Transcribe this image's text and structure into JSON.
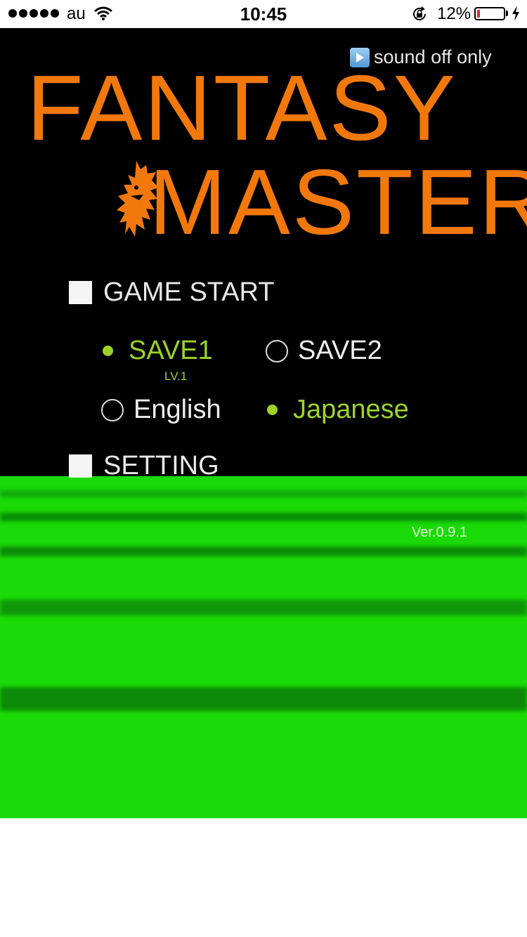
{
  "status_bar": {
    "carrier": "au",
    "time": "10:45",
    "battery_percent": "12%",
    "battery_level": 0.12,
    "signal_bars": 5
  },
  "game": {
    "sound_button_label": "sound off only",
    "title_line1": "FANTASY",
    "title_line2": "MASTER",
    "menu": {
      "game_start": "GAME START",
      "setting": "SETTING"
    },
    "save_slots": [
      {
        "label": "SAVE1",
        "selected": true,
        "level": "LV.1"
      },
      {
        "label": "SAVE2",
        "selected": false
      }
    ],
    "languages": [
      {
        "label": "English",
        "selected": false
      },
      {
        "label": "Japanese",
        "selected": true
      }
    ],
    "version": "Ver.0.9.1"
  },
  "colors": {
    "title": "#f2780c",
    "selected": "#9dd327",
    "ground": "#1adb07",
    "background": "#000000"
  }
}
